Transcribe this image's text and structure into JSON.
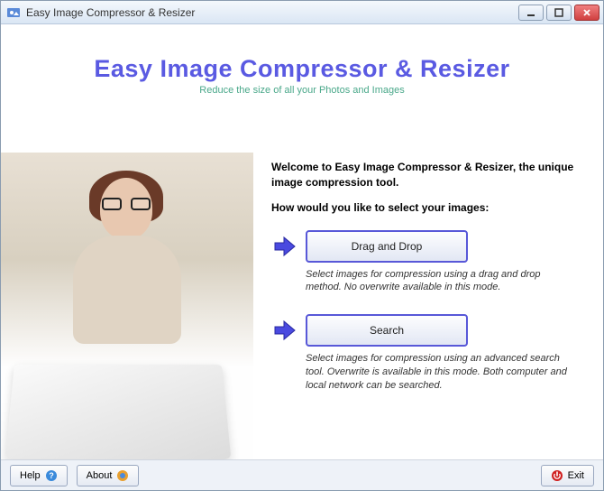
{
  "window": {
    "title": "Easy Image Compressor & Resizer"
  },
  "header": {
    "title": "Easy Image Compressor & Resizer",
    "tagline": "Reduce the size of all your Photos and Images"
  },
  "main": {
    "welcome": "Welcome to Easy Image Compressor & Resizer, the unique image compression tool.",
    "prompt": "How would you like to select your images:",
    "options": [
      {
        "label": "Drag and Drop",
        "description": "Select images for compression using a drag and drop method. No overwrite available in this mode."
      },
      {
        "label": "Search",
        "description": "Select images for compression using an advanced search tool. Overwrite is available in this mode.  Both computer and local network can be searched."
      }
    ]
  },
  "footer": {
    "help": "Help",
    "about": "About",
    "exit": "Exit"
  }
}
